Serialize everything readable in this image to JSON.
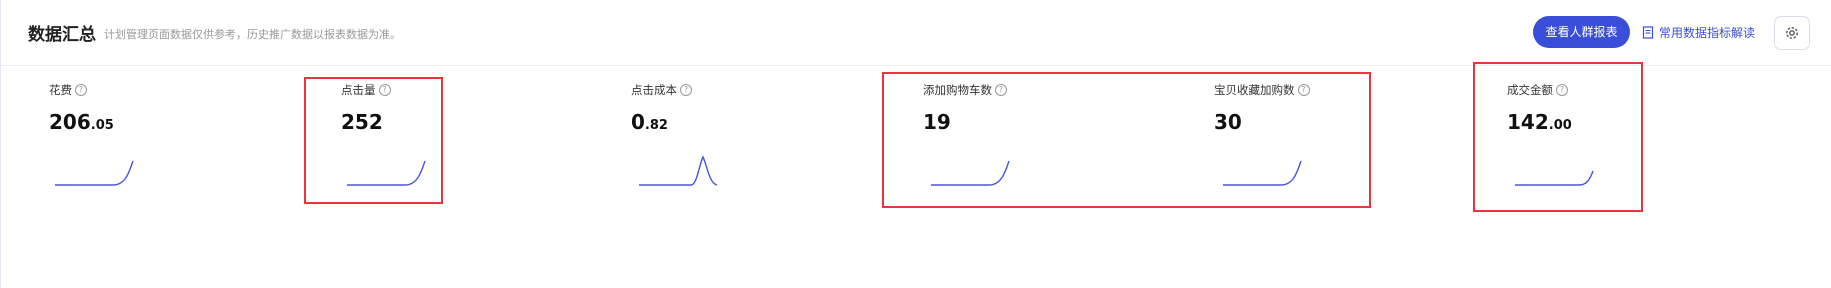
{
  "header": {
    "title": "数据汇总",
    "subtitle": "计划管理页面数据仅供参考，历史推广数据以报表数据为准。",
    "report_button": "查看人群报表",
    "doc_link": "常用数据指标解读"
  },
  "metrics": [
    {
      "label": "花费",
      "int": "206",
      "dec": ".05",
      "trend": "rise"
    },
    {
      "label": "点击量",
      "int": "252",
      "dec": "",
      "trend": "rise"
    },
    {
      "label": "点击成本",
      "int": "0",
      "dec": ".82",
      "trend": "spike"
    },
    {
      "label": "添加购物车数",
      "int": "19",
      "dec": "",
      "trend": "rise"
    },
    {
      "label": "宝贝收藏加购数",
      "int": "30",
      "dec": "",
      "trend": "rise"
    },
    {
      "label": "成交金额",
      "int": "142",
      "dec": ".00",
      "trend": "rise"
    }
  ],
  "colors": {
    "accent": "#3b4ed8",
    "sparkline": "#4b55d6",
    "highlight_box": "#e8353b"
  }
}
